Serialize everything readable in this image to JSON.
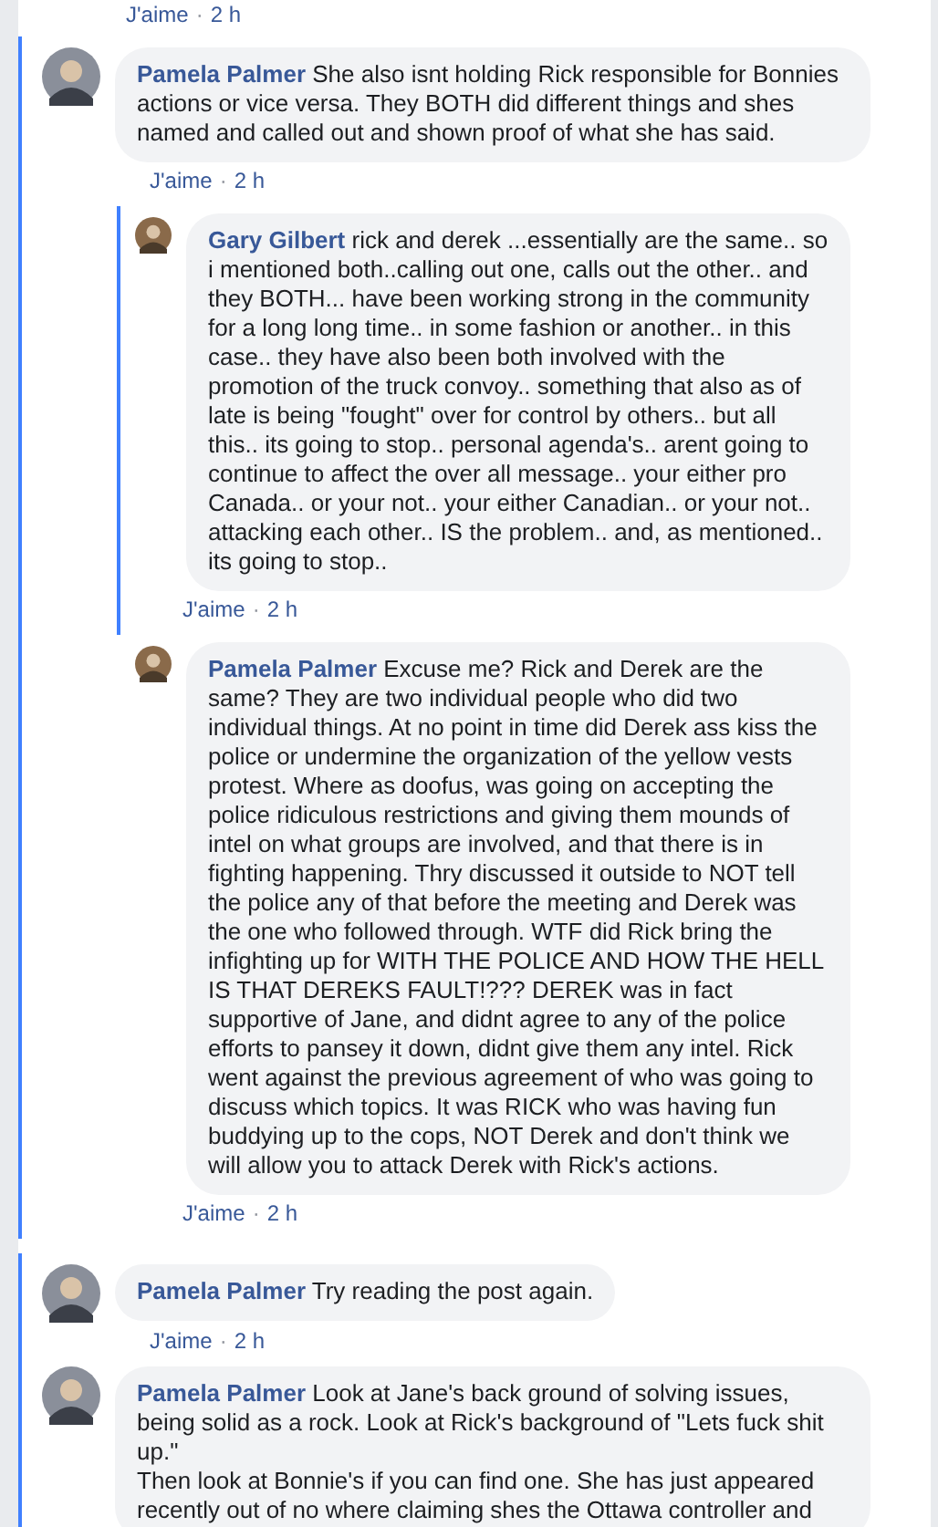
{
  "top_meta": {
    "like": "J'aime",
    "sep": "·",
    "time": "2 h"
  },
  "threads": [
    {
      "comments": [
        {
          "author": "Pamela Palmer",
          "text": "She also isnt holding Rick responsible for Bonnies actions or vice versa. They BOTH did different things and shes named and called out and shown proof of what she has said.",
          "like": "J'aime",
          "sep": "·",
          "time": "2 h",
          "replies": [
            {
              "author": "Gary Gilbert",
              "text": "rick and derek ...essentially are the same.. so i mentioned both..calling out one, calls out the other.. and they BOTH... have been working strong in the community for a long long time.. in some fashion or another.. in this case.. they have also been both involved with the promotion of the truck convoy.. something that also as of late is being \"fought\" over for control by others.. but all this.. its going to stop.. personal agenda's.. arent going to continue to affect the over all message.. your either pro Canada.. or your not.. your either Canadian.. or your not.. attacking each other.. IS the problem.. and, as mentioned.. its going to stop..",
              "like": "J'aime",
              "sep": "·",
              "time": "2 h"
            },
            {
              "author": "Pamela Palmer",
              "text": "Excuse me? Rick and Derek are the same? They are two individual people who did two individual things. At no point in time did Derek ass kiss the police or undermine the organization of the yellow vests protest. Where as doofus, was going on accepting the police ridiculous restrictions and giving them mounds of intel on what groups are involved, and that there is in fighting happening. Thry discussed it outside to NOT tell the police any of that before the meeting and Derek was the one who followed through. WTF did Rick bring the infighting up for WITH THE POLICE AND HOW THE HELL IS THAT DEREKS FAULT!??? DEREK was in fact supportive of Jane, and didnt agree to any of the police efforts to pansey it down, didnt give them any intel. Rick went against the previous agreement of who was going to discuss which topics. It was RICK who was having fun buddying up to the cops, NOT Derek and don't think we will allow you to attack Derek with Rick's actions.",
              "like": "J'aime",
              "sep": "·",
              "time": "2 h"
            }
          ]
        }
      ]
    },
    {
      "comments": [
        {
          "author": "Pamela Palmer",
          "text": "Try reading the post again.",
          "like": "J'aime",
          "sep": "·",
          "time": "2 h"
        },
        {
          "author": "Pamela Palmer",
          "text": "Look at Jane's back ground of solving issues, being solid as a rock. Look at Rick's background of \"Lets fuck shit up.\"\nThen look at Bonnie's if you can find one. She has just appeared recently out of no where claiming shes the Ottawa controller and"
        }
      ]
    }
  ]
}
